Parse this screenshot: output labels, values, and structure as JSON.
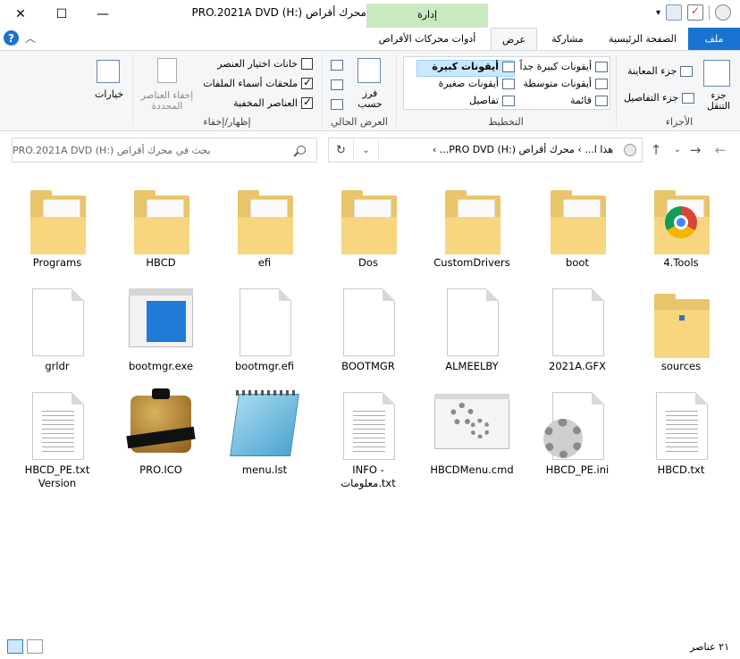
{
  "window": {
    "title": "محرك أقراص PRO.2021A DVD (H:)",
    "minimize": "—",
    "maximize": "☐",
    "close": "✕",
    "context_tab_group": "إدارة",
    "help": "?",
    "collapse": "︿"
  },
  "tabs": {
    "file": "ملف",
    "home": "الصفحة الرئيسية",
    "share": "مشاركة",
    "view": "عرض",
    "drive_tools": "أدوات محركات الأقراص"
  },
  "ribbon": {
    "panes": {
      "label": "الأجزاء",
      "nav_pane": "جزء التنقل",
      "preview_pane": "جزء المعاينة",
      "details_pane": "جزء التفاصيل"
    },
    "layout": {
      "label": "التخطيط",
      "extra_large": "أيقونات كبيرة جداً",
      "large": "أيقونات كبيرة",
      "medium": "أيقونات متوسطة",
      "small": "أيقونات صغيرة",
      "list": "قائمة",
      "details": "تفاصيل"
    },
    "current_view": {
      "label": "العرض الحالي",
      "sort_by": "فرز حسب"
    },
    "show_hide": {
      "label": "إظهار/إخفاء",
      "item_checkboxes": "خانات اختيار العنصر",
      "file_extensions": "ملحقات أسماء الملفات",
      "hidden_items": "العناصر المخفية",
      "hide_selected": "إخفاء العناصر المحددة",
      "item_checkboxes_checked": false,
      "file_extensions_checked": true,
      "hidden_items_checked": true
    },
    "options": "خيارات"
  },
  "address": {
    "path": "هذا ا...  ›  محرك أقراص PRO DVD (H:)...  ›",
    "search_placeholder": "بحث في محرك أقراص PRO.2021A DVD (H:)"
  },
  "items": [
    {
      "name": "4.Tools",
      "kind": "folder-chrome"
    },
    {
      "name": "boot",
      "kind": "folder"
    },
    {
      "name": "CustomDrivers",
      "kind": "folder"
    },
    {
      "name": "Dos",
      "kind": "folder"
    },
    {
      "name": "efi",
      "kind": "folder"
    },
    {
      "name": "HBCD",
      "kind": "folder"
    },
    {
      "name": "Programs",
      "kind": "folder"
    },
    {
      "name": "sources",
      "kind": "folder-empty"
    },
    {
      "name": "2021A.GFX",
      "kind": "file"
    },
    {
      "name": "ALMEELBY",
      "kind": "file"
    },
    {
      "name": "BOOTMGR",
      "kind": "file"
    },
    {
      "name": "bootmgr.efi",
      "kind": "file"
    },
    {
      "name": "bootmgr.exe",
      "kind": "app"
    },
    {
      "name": "grldr",
      "kind": "file"
    },
    {
      "name": "HBCD.txt",
      "kind": "text"
    },
    {
      "name": "HBCD_PE.ini",
      "kind": "ini"
    },
    {
      "name": "HBCDMenu.cmd",
      "kind": "cmd"
    },
    {
      "name": "INFO - معلومات.txt",
      "kind": "text"
    },
    {
      "name": "menu.lst",
      "kind": "notepad"
    },
    {
      "name": "PRO.ICO",
      "kind": "logo"
    },
    {
      "name": "HBCD_PE.txt Version",
      "kind": "text"
    }
  ],
  "status": {
    "count": "٢١ عناصر"
  },
  "colors": {
    "accent": "#1a73d0",
    "context_tab": "#c8eac0",
    "folder": "#f7d67f"
  }
}
